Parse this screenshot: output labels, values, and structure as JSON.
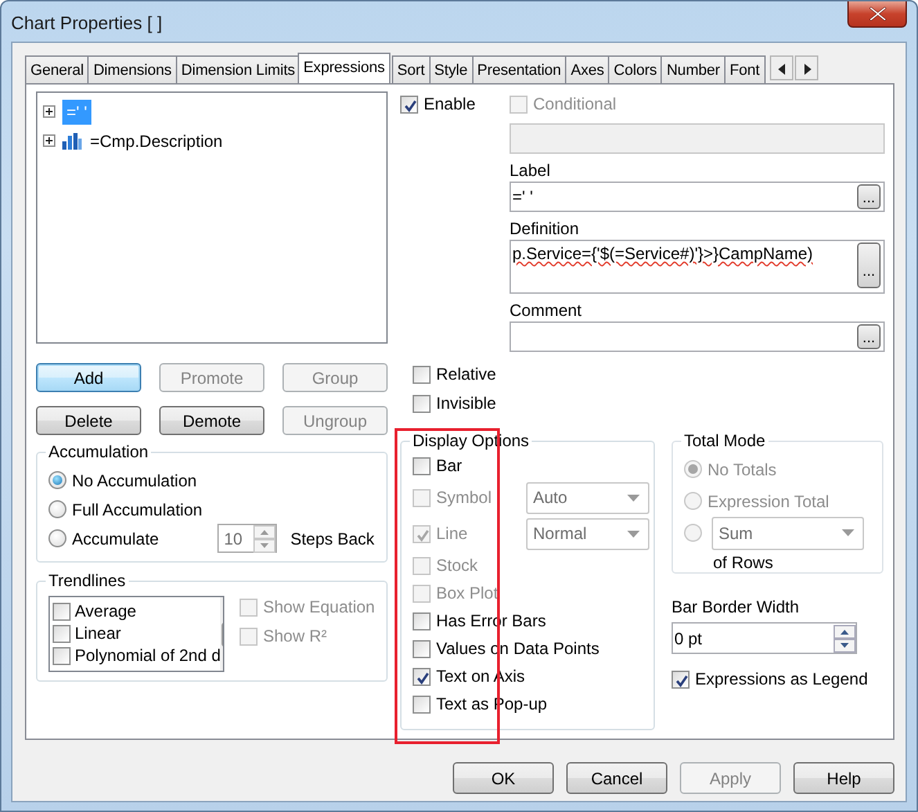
{
  "window": {
    "title": "Chart Properties [ ]"
  },
  "tabs": [
    {
      "label": "General",
      "selected": false
    },
    {
      "label": "Dimensions",
      "selected": false
    },
    {
      "label": "Dimension Limits",
      "selected": false
    },
    {
      "label": "Expressions",
      "selected": true
    },
    {
      "label": "Sort",
      "selected": false
    },
    {
      "label": "Style",
      "selected": false
    },
    {
      "label": "Presentation",
      "selected": false
    },
    {
      "label": "Axes",
      "selected": false
    },
    {
      "label": "Colors",
      "selected": false
    },
    {
      "label": "Number",
      "selected": false
    },
    {
      "label": "Font",
      "selected": false
    }
  ],
  "expressions": [
    {
      "label": "=' '",
      "kind": "plain",
      "selected": true
    },
    {
      "label": "=Cmp.Description",
      "kind": "bar",
      "selected": false
    }
  ],
  "expression_buttons": [
    {
      "label": "Add",
      "disabled": false,
      "focused": true
    },
    {
      "label": "Promote",
      "disabled": true,
      "focused": false
    },
    {
      "label": "Group",
      "disabled": true,
      "focused": false
    },
    {
      "label": "Delete",
      "disabled": false,
      "focused": false
    },
    {
      "label": "Demote",
      "disabled": false,
      "focused": false
    },
    {
      "label": "Ungroup",
      "disabled": true,
      "focused": false
    }
  ],
  "accumulation": {
    "title": "Accumulation",
    "options": [
      {
        "label": "No Accumulation",
        "selected": true
      },
      {
        "label": "Full Accumulation",
        "selected": false
      },
      {
        "label": "Accumulate",
        "selected": false
      }
    ],
    "steps": "10",
    "steps_label": "Steps Back"
  },
  "trendlines": {
    "title": "Trendlines",
    "items": [
      {
        "label": "Average",
        "checked": false
      },
      {
        "label": "Linear",
        "checked": false
      },
      {
        "label": "Polynomial of 2nd d",
        "checked": false
      }
    ],
    "options": [
      {
        "label": "Show Equation",
        "checked": false,
        "disabled": true
      },
      {
        "label": "Show R²",
        "checked": false,
        "disabled": true
      }
    ]
  },
  "enable": {
    "label": "Enable",
    "checked": true
  },
  "conditional": {
    "label": "Conditional",
    "checked": false,
    "disabled": true
  },
  "label_field": {
    "label": "Label",
    "value": "=' '",
    "button": "..."
  },
  "definition": {
    "label": "Definition",
    "value": "p.Service={'$(=Service#)'}>}CampName)",
    "button": "..."
  },
  "comment": {
    "label": "Comment",
    "button": "..."
  },
  "relative": {
    "label": "Relative",
    "checked": false
  },
  "invisible": {
    "label": "Invisible",
    "checked": false
  },
  "display_options": {
    "title": "Display Options",
    "items": [
      {
        "label": "Bar",
        "checked": false,
        "disabled": false
      },
      {
        "label": "Symbol",
        "checked": false,
        "disabled": true,
        "select": "Auto"
      },
      {
        "label": "Line",
        "checked": true,
        "disabled": true,
        "select": "Normal"
      },
      {
        "label": "Stock",
        "checked": false,
        "disabled": true
      },
      {
        "label": "Box Plot",
        "checked": false,
        "disabled": true
      },
      {
        "label": "Has Error Bars",
        "checked": false,
        "disabled": false
      },
      {
        "label": "Values on Data Points",
        "checked": false,
        "disabled": false
      },
      {
        "label": "Text on Axis",
        "checked": true,
        "disabled": false
      },
      {
        "label": "Text as Pop-up",
        "checked": false,
        "disabled": false
      }
    ]
  },
  "total_mode": {
    "title": "Total Mode",
    "disabled": true,
    "options": [
      {
        "kind": "label",
        "label": "No Totals",
        "selected": true
      },
      {
        "kind": "label",
        "label": "Expression Total",
        "selected": false
      },
      {
        "kind": "select",
        "value": "Sum",
        "selected": false
      }
    ],
    "suffix": "of Rows"
  },
  "bar_border_width": {
    "label": "Bar Border Width",
    "value": "0 pt"
  },
  "expressions_as_legend": {
    "label": "Expressions as Legend",
    "checked": true
  },
  "footer_buttons": [
    {
      "label": "OK",
      "disabled": false
    },
    {
      "label": "Cancel",
      "disabled": false
    },
    {
      "label": "Apply",
      "disabled": true
    },
    {
      "label": "Help",
      "disabled": false
    }
  ],
  "highlight": true
}
